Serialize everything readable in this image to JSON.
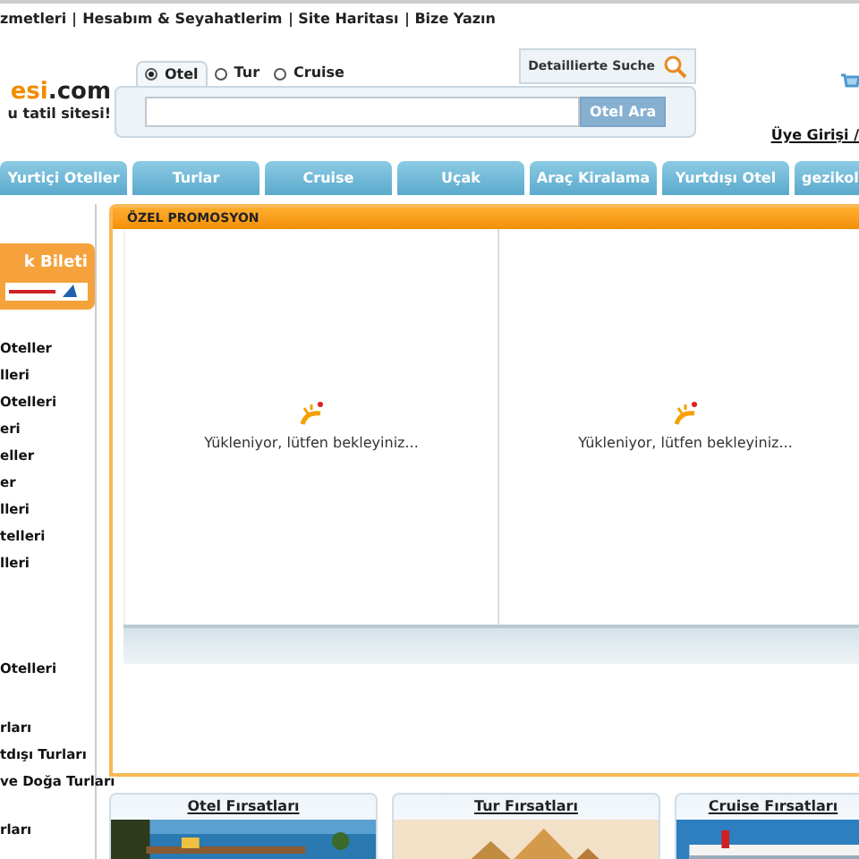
{
  "top_links": [
    "zmetleri",
    "Hesabım & Seyahatlerim",
    "Site Haritası",
    "Bize Yazın"
  ],
  "logo": {
    "accent": "esi",
    ".com": ".com",
    "tagline": "u tatil sitesi!"
  },
  "search": {
    "tabs": [
      {
        "label": "Otel",
        "selected": true
      },
      {
        "label": "Tur",
        "selected": false
      },
      {
        "label": "Cruise",
        "selected": false
      }
    ],
    "detailed_button": "Detaillierte Suche",
    "submit": "Otel Ara"
  },
  "login_link": "Üye Girişi / ",
  "nav": [
    "Yurtiçi Oteller",
    "Turlar",
    "Cruise",
    "Uçak",
    "Araç Kiralama",
    "Yurtdışı Otel",
    "gezikol"
  ],
  "sidebar": {
    "banner_title": "k Bileti",
    "groups": [
      [
        "Oteller",
        "lleri",
        "Otelleri",
        "eri",
        "eller",
        "er",
        "lleri",
        "telleri",
        "lleri"
      ],
      [
        "Otelleri"
      ],
      [
        "rları",
        "tdışı Turları",
        "ve Doğa Turları"
      ],
      [
        "rları"
      ]
    ]
  },
  "promo": {
    "title": "ÖZEL PROMOSYON",
    "panels": [
      "Yükleniyor, lütfen bekleyiniz...",
      "Yükleniyor, lütfen bekleyiniz..."
    ]
  },
  "deals": [
    {
      "title": "Otel Fırsatları",
      "kind": "picture"
    },
    {
      "title": "Tur Fırsatları",
      "kind": "picture"
    },
    {
      "title": "Cruise Fırsatları",
      "kind": "picture"
    }
  ]
}
